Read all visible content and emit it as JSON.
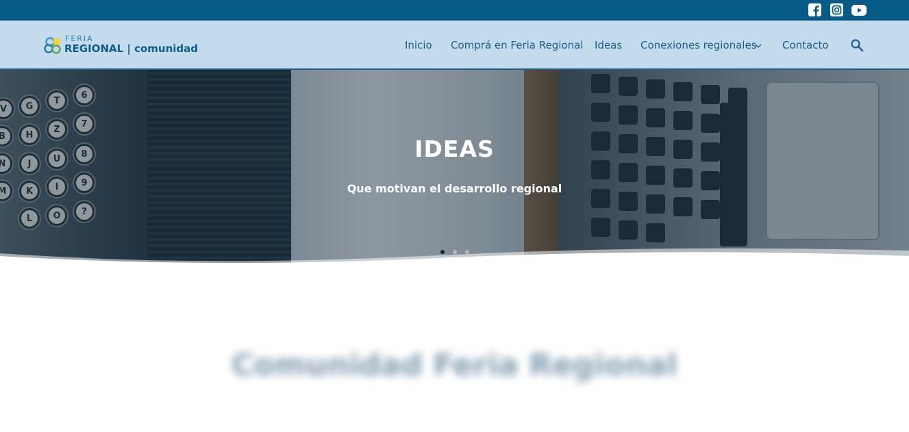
{
  "topbar": {
    "social": [
      "facebook-icon",
      "instagram-icon",
      "youtube-icon"
    ],
    "background": "#055a85"
  },
  "header": {
    "logo_small": "FERIA",
    "logo_main": "REGIONAL | comunidad",
    "nav": [
      {
        "label": "Inicio"
      },
      {
        "label": "Comprá en Feria Regional"
      },
      {
        "label": "Ideas"
      },
      {
        "label": "Conexiones regionales",
        "has_dropdown": true
      },
      {
        "label": "Contacto"
      }
    ],
    "search_icon": "search-icon",
    "background": "#c4dbee",
    "text_color": "#1d5f88"
  },
  "hero": {
    "title": "IDEAS",
    "subtitle": "Que motivan el desarrollo regional",
    "slides": 3,
    "active_slide": 1
  },
  "section": {
    "heading": "Comunidad Feria Regional"
  }
}
